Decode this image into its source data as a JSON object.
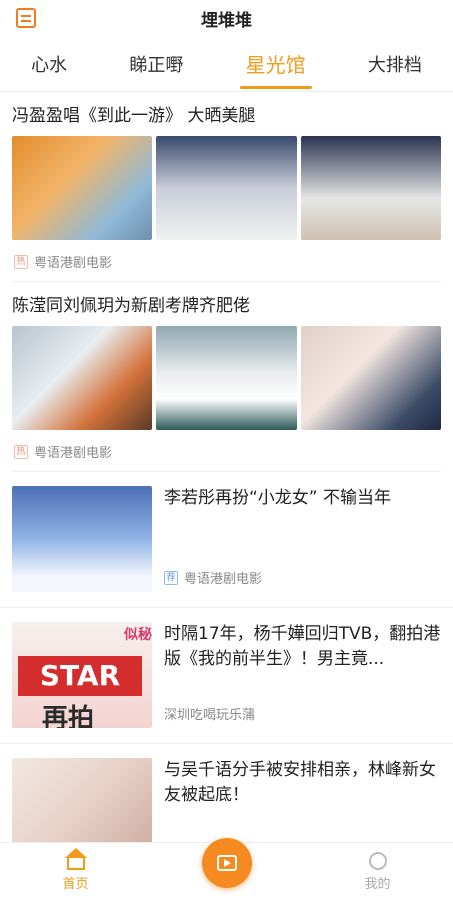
{
  "app": {
    "title": "埋堆堆"
  },
  "tabs": [
    "心水",
    "睇正嘢",
    "星光馆",
    "大排档"
  ],
  "active_tab": "星光馆",
  "articles": [
    {
      "headline": "冯盈盈唱《到此一游》 大晒美腿",
      "badge": "热",
      "source": "粤语港剧电影"
    },
    {
      "headline": "陈滢同刘佩玥为新剧考牌齐肥佬",
      "badge": "热",
      "source": "粤语港剧电影"
    }
  ],
  "row_articles": [
    {
      "headline": "李若彤再扮“小龙女” 不输当年",
      "badge": "荐",
      "source": "粤语港剧电影"
    },
    {
      "headline": "时隔17年，杨千嬅回归TVB，翻拍港版《我的前半生》！男主竟...",
      "source": "深圳吃喝玩乐蒲",
      "image_text": "STAR",
      "image_text2": "再拍",
      "image_text3": "似秘"
    },
    {
      "headline": "与吴千语分手被安排相亲，林峰新女友被起底！"
    }
  ],
  "nav": {
    "home": "首页",
    "mine": "我的"
  },
  "colors": {
    "accent": "#f29a1a",
    "center_button": "#f58a21"
  }
}
